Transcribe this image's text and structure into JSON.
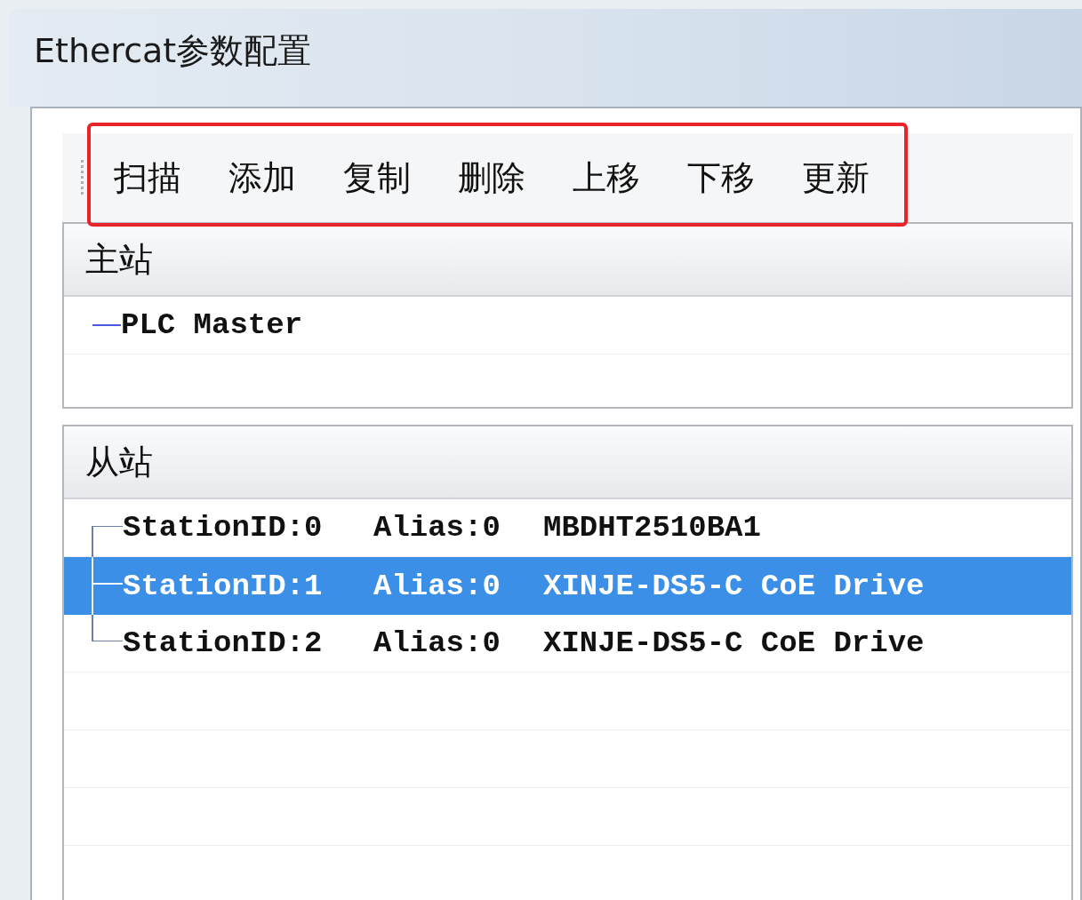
{
  "window": {
    "title": "Ethercat参数配置"
  },
  "toolbar": {
    "buttons": [
      "扫描",
      "添加",
      "复制",
      "删除",
      "上移",
      "下移",
      "更新"
    ]
  },
  "master": {
    "header": "主站",
    "items": [
      {
        "label": "PLC Master",
        "selected": false
      }
    ]
  },
  "slaves": {
    "header": "从站",
    "items": [
      {
        "station": "StationID:0",
        "alias": "Alias:0",
        "name": "MBDHT2510BA1",
        "selected": false
      },
      {
        "station": "StationID:1",
        "alias": "Alias:0",
        "name": "XINJE-DS5-C CoE Drive",
        "selected": true
      },
      {
        "station": "StationID:2",
        "alias": "Alias:0",
        "name": "XINJE-DS5-C CoE Drive",
        "selected": false
      }
    ]
  }
}
